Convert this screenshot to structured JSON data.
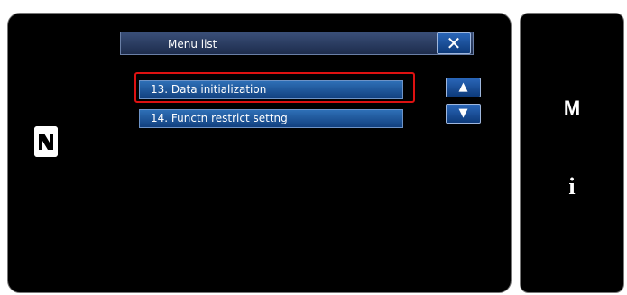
{
  "menu": {
    "title": "Menu list",
    "close_label": "✕",
    "scroll_up_label": "▲",
    "scroll_down_label": "▼",
    "items": [
      {
        "label": "13.  Data initialization",
        "selected": true
      },
      {
        "label": "14.  Functn restrict settng",
        "selected": false
      }
    ]
  },
  "side": {
    "m_label": "M",
    "info_label": "i"
  },
  "icons": {
    "nfc": "nfc-icon"
  },
  "colors": {
    "highlight": "#dd1111",
    "button_blue": "#1f5aa6",
    "background": "#000000"
  }
}
